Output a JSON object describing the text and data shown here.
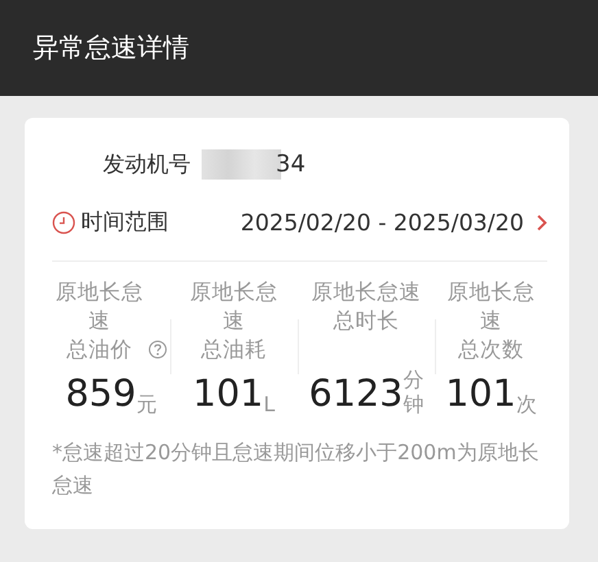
{
  "header": {
    "title": "异常怠速详情"
  },
  "engine": {
    "label": "发动机号",
    "value": "34",
    "redacted": true
  },
  "time_range": {
    "label": "时间范围",
    "value": "2025/02/20 - 2025/03/20"
  },
  "stats": [
    {
      "label_lines": [
        "原地长怠速",
        "总油价"
      ],
      "has_help": true,
      "value": "859",
      "unit": "元"
    },
    {
      "label_lines": [
        "原地长怠速",
        "总油耗"
      ],
      "has_help": false,
      "value": "101",
      "unit": "L"
    },
    {
      "label_lines": [
        "原地长怠速",
        "总时长"
      ],
      "has_help": false,
      "value": "6123",
      "unit": "分钟"
    },
    {
      "label_lines": [
        "原地长怠速",
        "总次数"
      ],
      "has_help": false,
      "value": "101",
      "unit": "次"
    }
  ],
  "note": "*怠速超过20分钟且怠速期间位移小于200m为原地长怠速"
}
